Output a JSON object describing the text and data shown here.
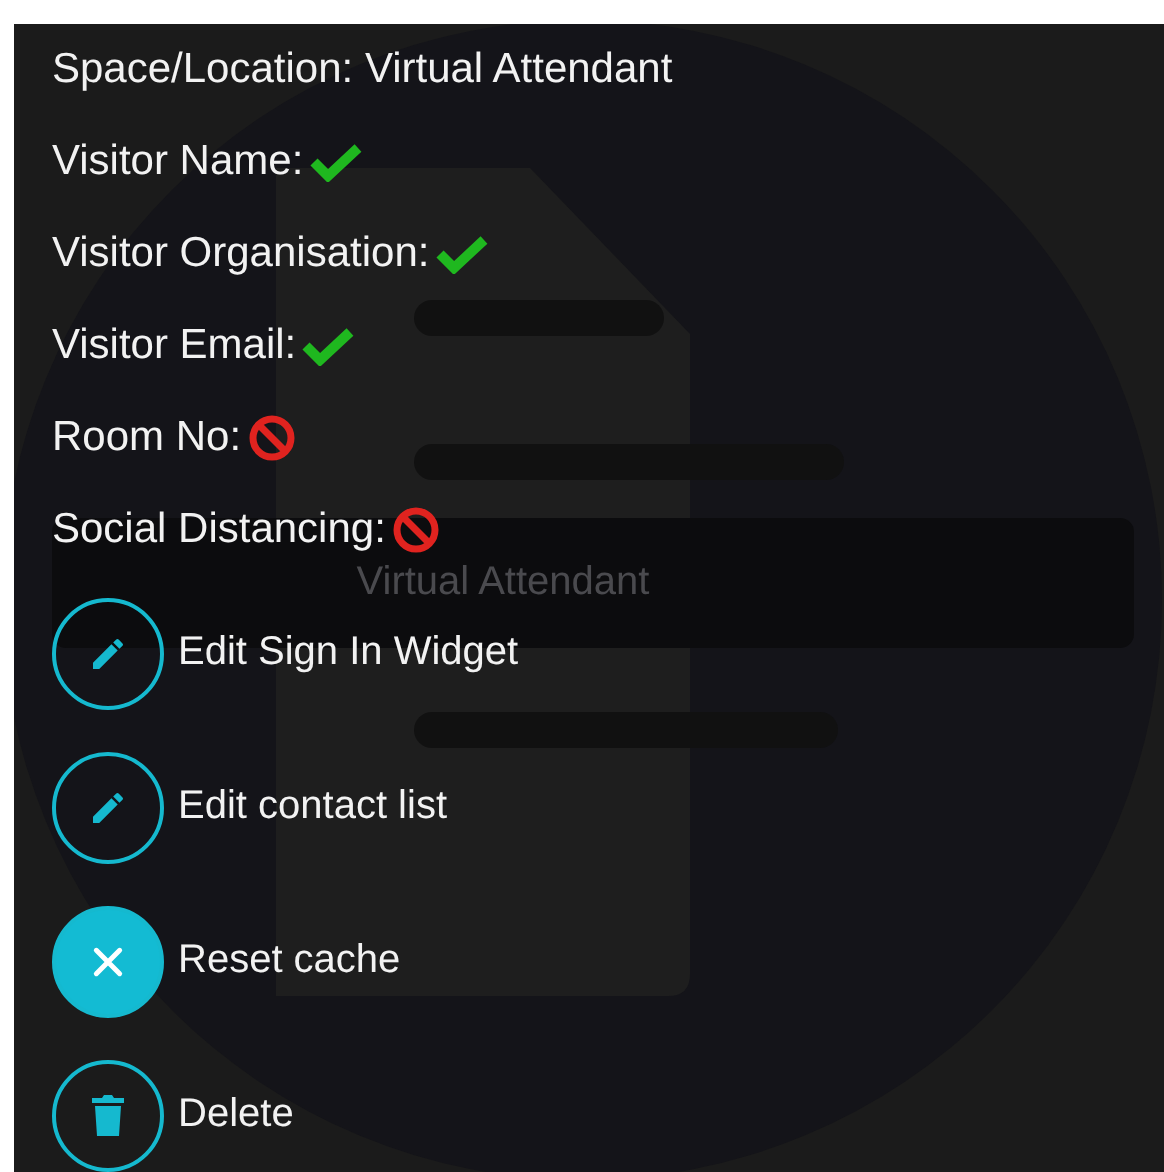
{
  "preview": {
    "title": "Virtual Attendant"
  },
  "details": [
    {
      "kind": "plain",
      "label": "Space/Location: Virtual Attendant"
    },
    {
      "kind": "status",
      "label": "Visitor Name:",
      "enabled": true
    },
    {
      "kind": "status",
      "label": "Visitor Organisation:",
      "enabled": true
    },
    {
      "kind": "status",
      "label": "Visitor Email:",
      "enabled": true
    },
    {
      "kind": "status",
      "label": "Room No:",
      "enabled": false
    },
    {
      "kind": "status",
      "label": "Social Distancing:",
      "enabled": false
    }
  ],
  "actions": [
    {
      "label": "Edit Sign In Widget",
      "kind": "pencil",
      "filled": false
    },
    {
      "label": "Edit contact list",
      "kind": "pencil",
      "filled": false
    },
    {
      "label": "Reset cache",
      "kind": "close",
      "filled": true
    },
    {
      "label": "Delete",
      "kind": "trash",
      "filled": false
    }
  ]
}
